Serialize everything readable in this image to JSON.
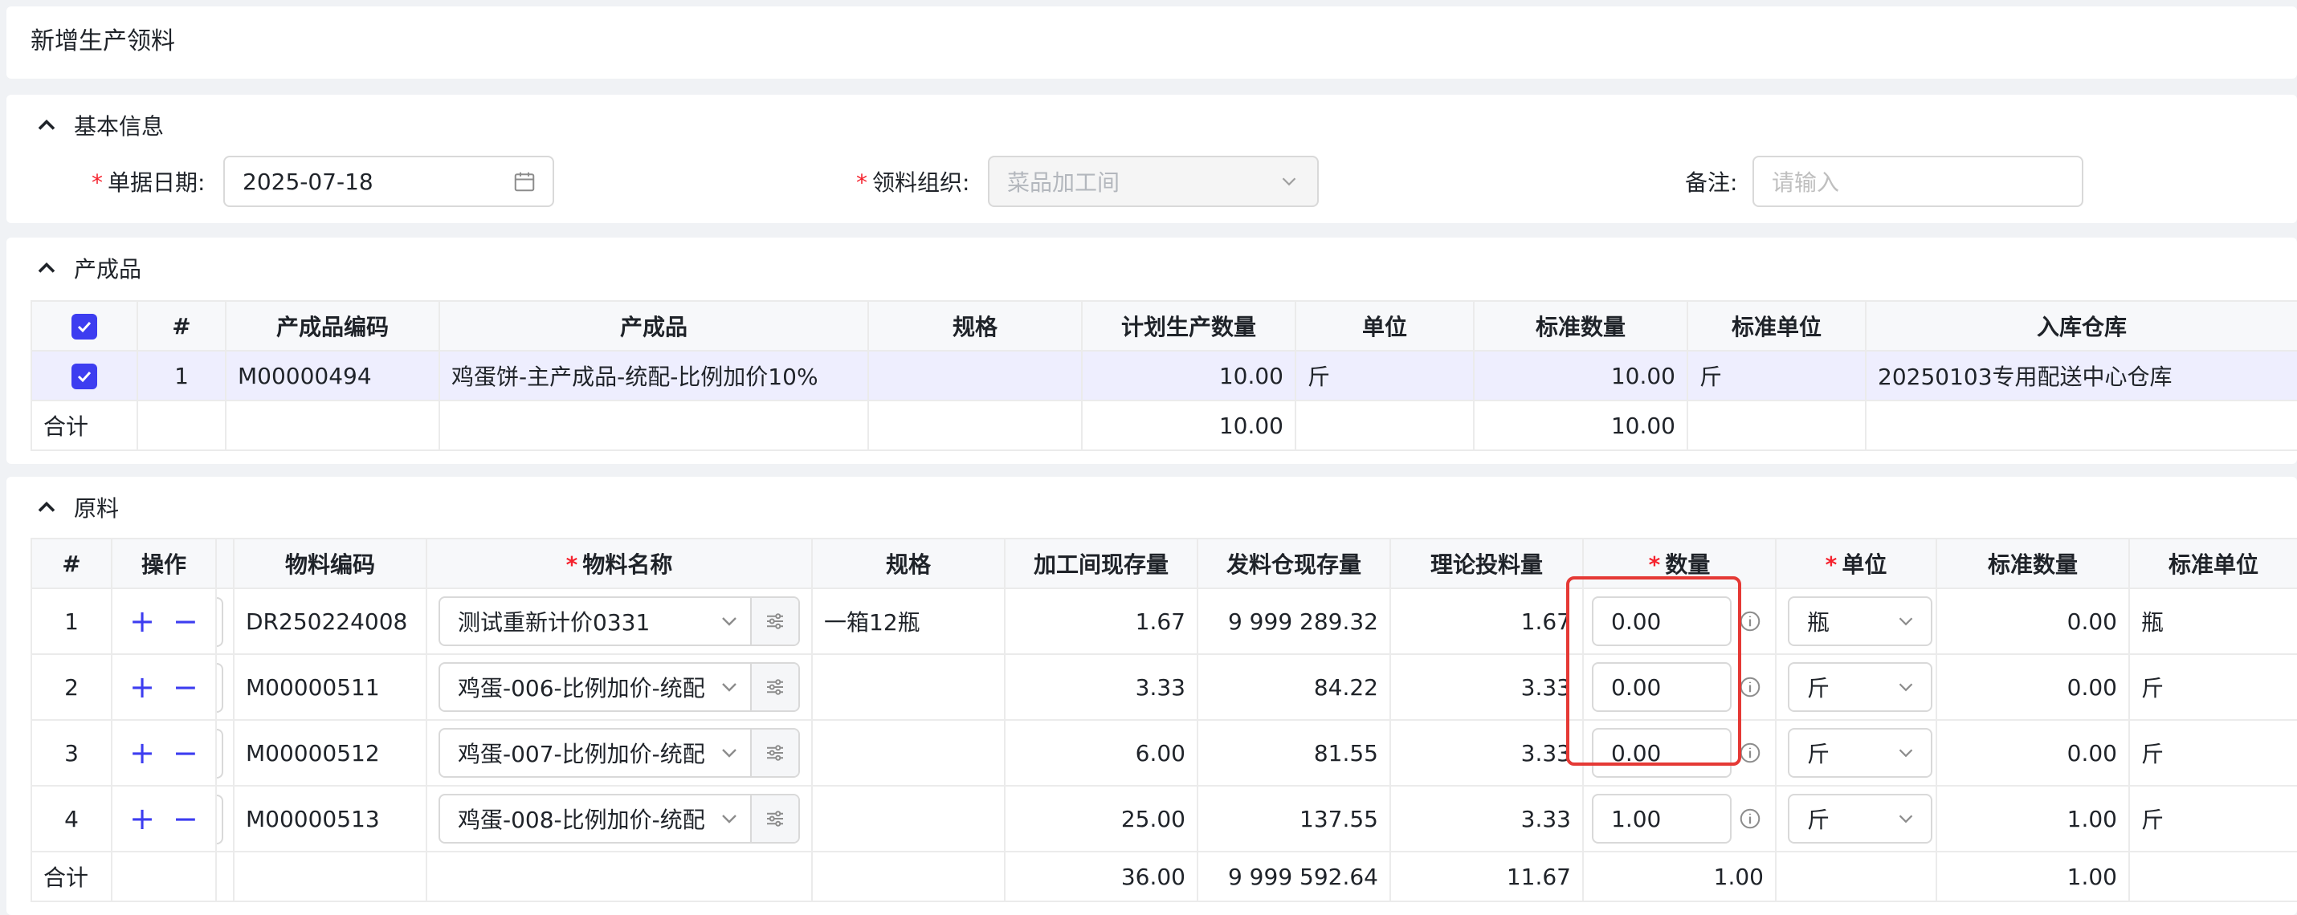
{
  "page_title": "新增生产领料",
  "basic": {
    "section_title": "基本信息",
    "date_label": "单据日期",
    "date_value": "2025-07-18",
    "org_label": "领料组织",
    "org_value": "菜品加工间",
    "remark_label": "备注",
    "remark_placeholder": "请输入",
    "colon": ":"
  },
  "product": {
    "section_title": "产成品",
    "headers": [
      "#",
      "产成品编码",
      "产成品",
      "规格",
      "计划生产数量",
      "单位",
      "标准数量",
      "标准单位",
      "入库仓库"
    ],
    "rows": [
      {
        "idx": "1",
        "code": "M00000494",
        "name": "鸡蛋饼-主产成品-统配-比例加价10%",
        "spec": "",
        "plan_qty": "10.00",
        "unit": "斤",
        "std_qty": "10.00",
        "std_unit": "斤",
        "warehouse": "20250103专用配送中心仓库",
        "checked": true
      }
    ],
    "sum_label": "合计",
    "sum_plan_qty": "10.00",
    "sum_std_qty": "10.00"
  },
  "material": {
    "section_title": "原料",
    "headers": [
      "#",
      "操作",
      "物料编码",
      "物料名称",
      "规格",
      "加工间现存量",
      "发料仓现存量",
      "理论投料量",
      "数量",
      "单位",
      "标准数量",
      "标准单位"
    ],
    "required_headers": [
      "物料名称",
      "数量",
      "单位"
    ],
    "add_symbol": "+",
    "remove_symbol": "−",
    "rows": [
      {
        "idx": "1",
        "code": "DR250224008",
        "name": "测试重新计价0331",
        "spec": "一箱12瓶",
        "proc_stock": "1.67",
        "wh_stock": "9 999 289.32",
        "theory": "1.67",
        "qty": "0.00",
        "unit": "瓶",
        "std_qty": "0.00",
        "std_unit": "瓶"
      },
      {
        "idx": "2",
        "code": "M00000511",
        "name": "鸡蛋-006-比例加价-统配",
        "spec": "",
        "proc_stock": "3.33",
        "wh_stock": "84.22",
        "theory": "3.33",
        "qty": "0.00",
        "unit": "斤",
        "std_qty": "0.00",
        "std_unit": "斤"
      },
      {
        "idx": "3",
        "code": "M00000512",
        "name": "鸡蛋-007-比例加价-统配",
        "spec": "",
        "proc_stock": "6.00",
        "wh_stock": "81.55",
        "theory": "3.33",
        "qty": "0.00",
        "unit": "斤",
        "std_qty": "0.00",
        "std_unit": "斤"
      },
      {
        "idx": "4",
        "code": "M00000513",
        "name": "鸡蛋-008-比例加价-统配",
        "spec": "",
        "proc_stock": "25.00",
        "wh_stock": "137.55",
        "theory": "3.33",
        "qty": "1.00",
        "unit": "斤",
        "std_qty": "1.00",
        "std_unit": "斤"
      }
    ],
    "sum_label": "合计",
    "sum_proc_stock": "36.00",
    "sum_wh_stock": "9 999 592.64",
    "sum_theory": "11.67",
    "sum_qty": "1.00",
    "sum_std_qty": "1.00"
  },
  "colors": {
    "accent": "#3d3df0",
    "required": "#f5222d",
    "highlight_box": "#e53935",
    "selected_row": "#eeeefe"
  }
}
